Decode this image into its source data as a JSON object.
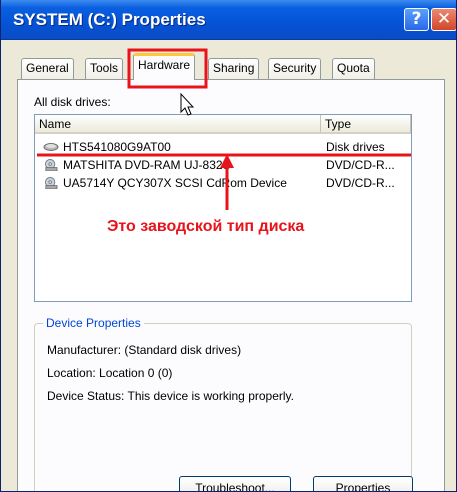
{
  "window": {
    "title": "SYSTEM (C:) Properties"
  },
  "titlebar_buttons": {
    "help": "?",
    "close": "✕"
  },
  "tabs": [
    {
      "label": "General"
    },
    {
      "label": "Tools"
    },
    {
      "label": "Hardware"
    },
    {
      "label": "Sharing"
    },
    {
      "label": "Security"
    },
    {
      "label": "Quota"
    }
  ],
  "hardware": {
    "list_label": "All disk drives:",
    "columns": {
      "name": "Name",
      "type": "Type"
    },
    "rows": [
      {
        "name": "HTS541080G9AT00",
        "type": "Disk drives",
        "icon": "hard-disk-icon"
      },
      {
        "name": "MATSHITA DVD-RAM UJ-832S",
        "type": "DVD/CD-R...",
        "icon": "cd-drive-icon"
      },
      {
        "name": "UA5714Y QCY307X SCSI CdRom Device",
        "type": "DVD/CD-R...",
        "icon": "cd-drive-icon"
      }
    ]
  },
  "device_properties": {
    "title": "Device Properties",
    "manufacturer": "Manufacturer: (Standard disk drives)",
    "location": "Location: Location 0 (0)",
    "status": "Device Status: This device is working properly."
  },
  "buttons": {
    "troubleshoot": "Troubleshoot...",
    "properties": "Properties"
  },
  "annotation": {
    "text": "Это  заводской тип диска",
    "color": "#e8141c"
  }
}
